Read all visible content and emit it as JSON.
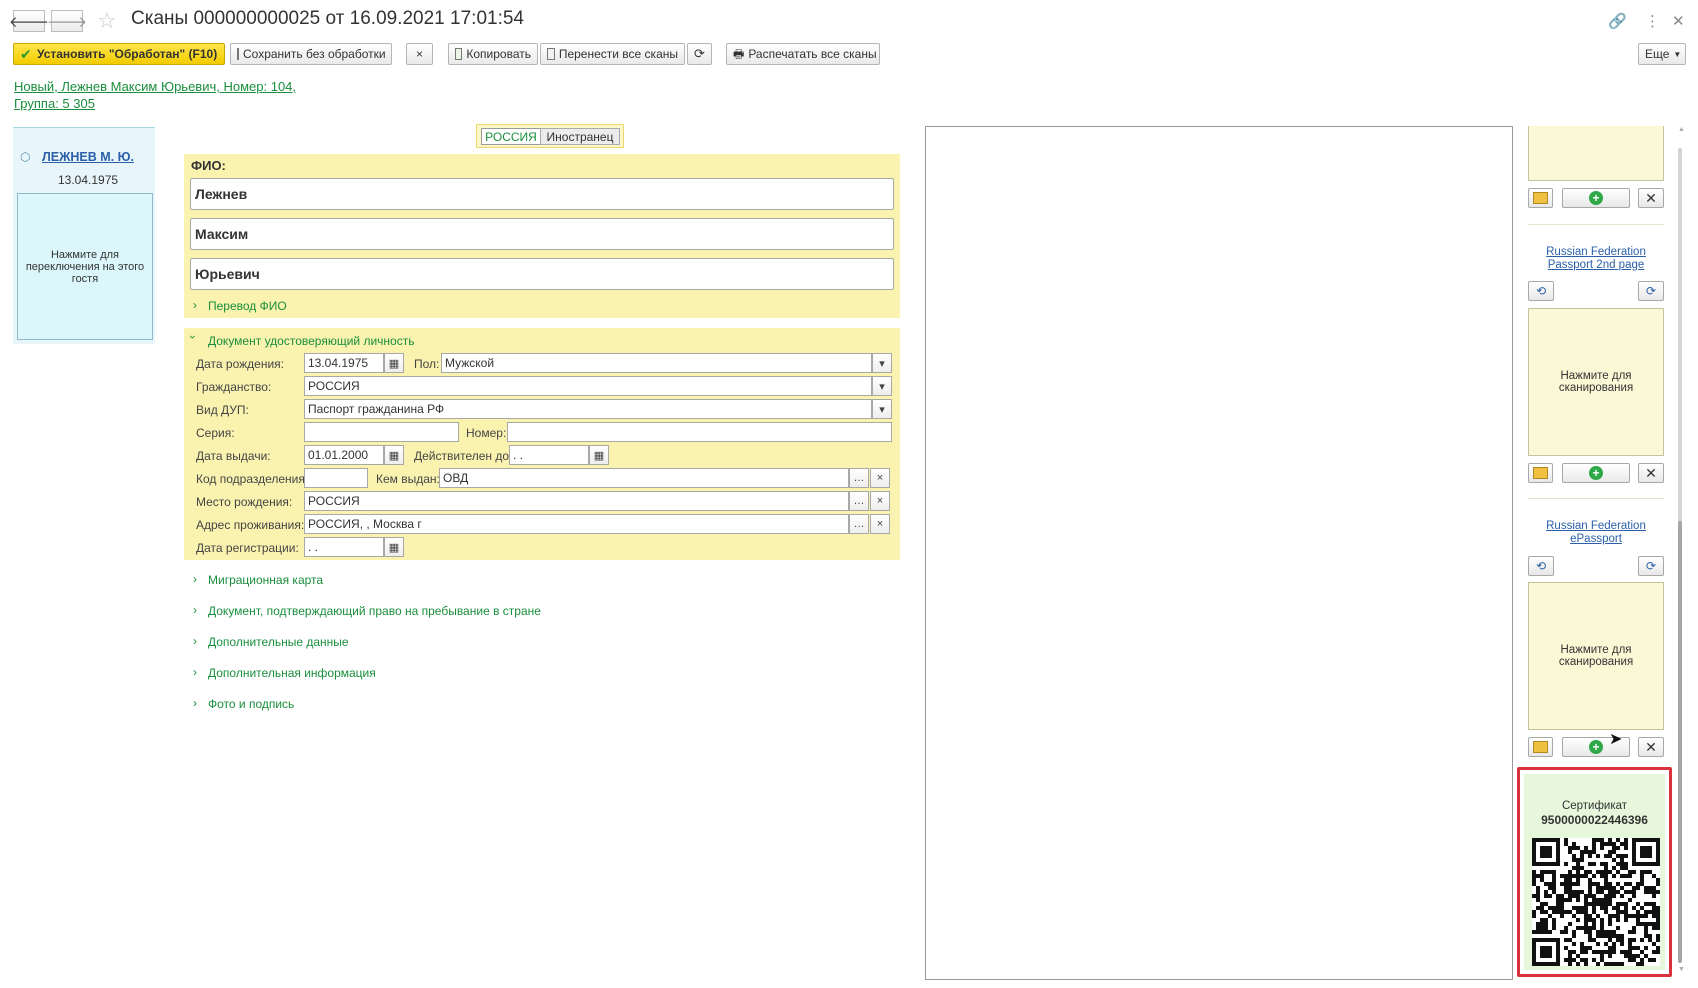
{
  "window": {
    "title": "Сканы 000000000025 от 16.09.2021 17:01:54"
  },
  "toolbar": {
    "set_processed": "Установить \"Обработан\" (F10)",
    "save_without": "Сохранить без обработки",
    "close_x": "×",
    "copy": "Копировать",
    "move_scans": "Перенести все сканы",
    "print_scans": "Распечатать все сканы",
    "more": "Еще"
  },
  "info": {
    "line1": "Новый, Лежнев Максим Юрьевич, Номер: 104,",
    "line2": "Группа: 5 305"
  },
  "guest": {
    "name": "ЛЕЖНЕВ М. Ю.",
    "birth": "13.04.1975",
    "switch_hint": "Нажмите для переключения на этого гостя"
  },
  "nationality": {
    "tab1": "РОССИЯ",
    "tab2": "Иностранец"
  },
  "fio": {
    "header": "ФИО:",
    "last": "Лежнев",
    "first": "Максим",
    "middle": "Юрьевич",
    "translate": "Перевод ФИО"
  },
  "doc": {
    "header": "Документ удостоверяющий личность",
    "birth_label": "Дата рождения:",
    "birth_value": "13.04.1975",
    "sex_label": "Пол:",
    "sex_value": "Мужской",
    "citizenship_label": "Гражданство:",
    "citizenship_value": "РОССИЯ",
    "doc_type_label": "Вид ДУП:",
    "doc_type_value": "Паспорт гражданина РФ",
    "series_label": "Серия:",
    "series_value": "",
    "number_label": "Номер:",
    "number_value": "",
    "issue_label": "Дата выдачи:",
    "issue_value": "01.01.2000",
    "valid_label": "Действителен до:",
    "valid_value": " .  .",
    "dept_label": "Код подразделения:",
    "dept_value": "",
    "issuer_label": "Кем выдан:",
    "issuer_value": "ОВД",
    "birthplace_label": "Место рождения:",
    "birthplace_value": "РОССИЯ",
    "address_label": "Адрес проживания:",
    "address_value": "РОССИЯ, , Москва г",
    "reg_label": "Дата регистрации:",
    "reg_value": " .  ."
  },
  "sections": {
    "migration": "Миграционная карта",
    "stay_doc": "Документ, подтверждающий право на пребывание в стране",
    "extra_data": "Дополнительные данные",
    "extra_info": "Дополнительная информация",
    "photo": "Фото и подпись"
  },
  "scans": {
    "item1_title": "Russian Federation Passport 2nd page",
    "item1_hint": "Нажмите для сканирования",
    "item2_title": "Russian Federation ePassport",
    "item2_hint": "Нажмите для сканирования"
  },
  "certificate": {
    "label": "Сертификат",
    "number": "9500000022446396"
  },
  "colors": {
    "accent_green": "#1a8e3c",
    "form_yellow": "#faf3b0",
    "highlight_red": "#d9323a"
  }
}
